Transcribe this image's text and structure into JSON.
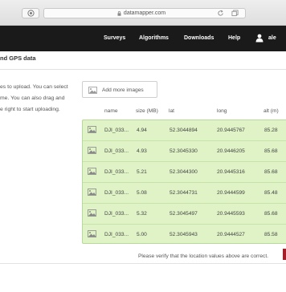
{
  "browser": {
    "url": "datamapper.com"
  },
  "topnav": {
    "items": [
      "Surveys",
      "Algorithms",
      "Downloads",
      "Help"
    ],
    "user_label": "ale"
  },
  "page": {
    "title": "nd GPS data",
    "instructions": [
      "es to upload. You can select",
      "me. You can also drag and",
      "e right to start uploading."
    ],
    "add_images_label": "Add more images",
    "columns": [
      "name",
      "size (MB)",
      "lat",
      "long",
      "alt (m)"
    ],
    "rows": [
      {
        "name": "DJI_033...",
        "size": "4.94",
        "lat": "52.3044894",
        "long": "20.9445767",
        "alt": "85.28"
      },
      {
        "name": "DJI_033...",
        "size": "4.93",
        "lat": "52.3045330",
        "long": "20.9446205",
        "alt": "85.68"
      },
      {
        "name": "DJI_033...",
        "size": "5.21",
        "lat": "52.3044300",
        "long": "20.9445316",
        "alt": "85.68"
      },
      {
        "name": "DJI_033...",
        "size": "5.08",
        "lat": "52.3044731",
        "long": "20.9444599",
        "alt": "85.48"
      },
      {
        "name": "DJI_033...",
        "size": "5.32",
        "lat": "52.3045497",
        "long": "20.9445593",
        "alt": "85.68"
      },
      {
        "name": "DJI_033...",
        "size": "5.00",
        "lat": "52.3045943",
        "long": "20.9444527",
        "alt": "85.58"
      }
    ],
    "footer_note": "Please verify that the location values above are correct."
  },
  "colors": {
    "header_bg": "#1a1a1a",
    "row_bg": "#dff3c6",
    "row_border": "#b7d99a",
    "accent_red": "#a41f2a"
  },
  "icons": {
    "browser_back": "shield-icon",
    "lock": "lock-icon",
    "reload": "reload-icon",
    "tabs": "tabs-icon",
    "user": "user-icon",
    "image": "image-icon"
  }
}
